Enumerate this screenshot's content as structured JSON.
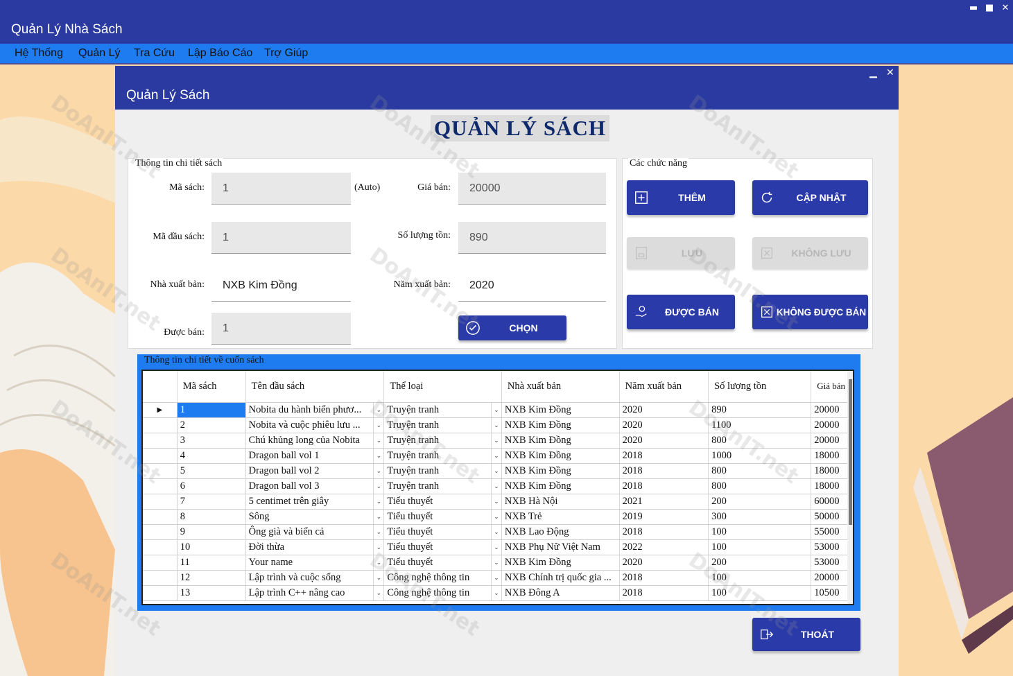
{
  "window": {
    "title": "Quản Lý Nhà Sách",
    "controls": {
      "minimize": "▬",
      "maximize": "■",
      "close": "✕"
    }
  },
  "menu": [
    "Hệ Thống",
    "Quản Lý",
    "Tra Cứu",
    "Lập Báo Cáo",
    "Trợ Giúp"
  ],
  "form": {
    "title": "Quản Lý Sách",
    "controls": {
      "minimize": "▁",
      "close": "✕"
    },
    "heading": "QUẢN LÝ SÁCH",
    "details": {
      "title": "Thông tin chi tiết sách",
      "ma_sach_label": "Mã sách:",
      "ma_sach_value": "1",
      "auto_label": "(Auto)",
      "gia_ban_label": "Giá bán:",
      "gia_ban_value": "20000",
      "ma_dau_sach_label": "Mã đầu sách:",
      "ma_dau_sach_value": "1",
      "so_luong_ton_label": "Số lượng tồn:",
      "so_luong_ton_value": "890",
      "nha_xuat_ban_label": "Nhà xuất bản:",
      "nha_xuat_ban_value": "NXB Kim Đồng",
      "nam_xuat_ban_label": "Năm xuất bản:",
      "nam_xuat_ban_value": "2020",
      "duoc_ban_label": "Được bán:",
      "duoc_ban_value": "1",
      "chon_label": "CHỌN"
    },
    "functions": {
      "title": "Các chức năng",
      "them": "THÊM",
      "cap_nhat": "CẬP NHẬT",
      "luu": "LƯU",
      "khong_luu": "KHÔNG LƯU",
      "duoc_ban": "ĐƯỢC BÁN",
      "khong_duoc_ban": "KHÔNG ĐƯỢC BÁN"
    },
    "grid": {
      "title": "Thông tin chi tiết về cuốn sách",
      "columns": [
        "Mã sách",
        "Tên đầu sách",
        "Thể loại",
        "Nhà xuất bản",
        "Năm xuất bản",
        "Số lượng tồn",
        "Giá bán"
      ],
      "rows": [
        [
          "1",
          "Nobita du hành biển phươ...",
          "Truyện tranh",
          "NXB Kim Đồng",
          "2020",
          "890",
          "20000"
        ],
        [
          "2",
          "Nobita và cuộc phiêu lưu ...",
          "Truyện tranh",
          "NXB Kim Đồng",
          "2020",
          "1100",
          "20000"
        ],
        [
          "3",
          "Chú khủng long của Nobita",
          "Truyện tranh",
          "NXB Kim Đồng",
          "2020",
          "800",
          "20000"
        ],
        [
          "4",
          "Dragon ball vol 1",
          "Truyện tranh",
          "NXB Kim Đồng",
          "2018",
          "1000",
          "18000"
        ],
        [
          "5",
          "Dragon ball vol 2",
          "Truyện tranh",
          "NXB Kim Đồng",
          "2018",
          "800",
          "18000"
        ],
        [
          "6",
          "Dragon ball vol 3",
          "Truyện tranh",
          "NXB Kim Đồng",
          "2018",
          "800",
          "18000"
        ],
        [
          "7",
          "5 centimet trên giây",
          "Tiểu thuyết",
          "NXB Hà Nội",
          "2021",
          "200",
          "60000"
        ],
        [
          "8",
          "Sông",
          "Tiểu thuyết",
          "NXB Trẻ",
          "2019",
          "300",
          "50000"
        ],
        [
          "9",
          "Ông già và biển cả",
          "Tiểu thuyết",
          "NXB Lao Động",
          "2018",
          "100",
          "55000"
        ],
        [
          "10",
          "Đời thừa",
          "Tiểu thuyết",
          "NXB Phụ Nữ Việt Nam",
          "2022",
          "100",
          "53000"
        ],
        [
          "11",
          "Your name",
          "Tiểu thuyết",
          "NXB Kim Đồng",
          "2020",
          "200",
          "53000"
        ],
        [
          "12",
          "Lập trình và cuộc sống",
          "Công nghệ thông tin",
          "NXB Chính trị quốc gia ...",
          "2018",
          "100",
          "20000"
        ],
        [
          "13",
          "Lập trình C++ nâng cao",
          "Công nghệ thông tin",
          "NXB Đông A",
          "2018",
          "100",
          "10500"
        ]
      ]
    },
    "thoat": "THOÁT"
  },
  "watermark": "DoAnIT.net",
  "colors": {
    "titlebar": "#2b3aa1",
    "menubar": "#1e7cf0",
    "button": "#2a3aa8",
    "heading": "#0e2a6c"
  }
}
